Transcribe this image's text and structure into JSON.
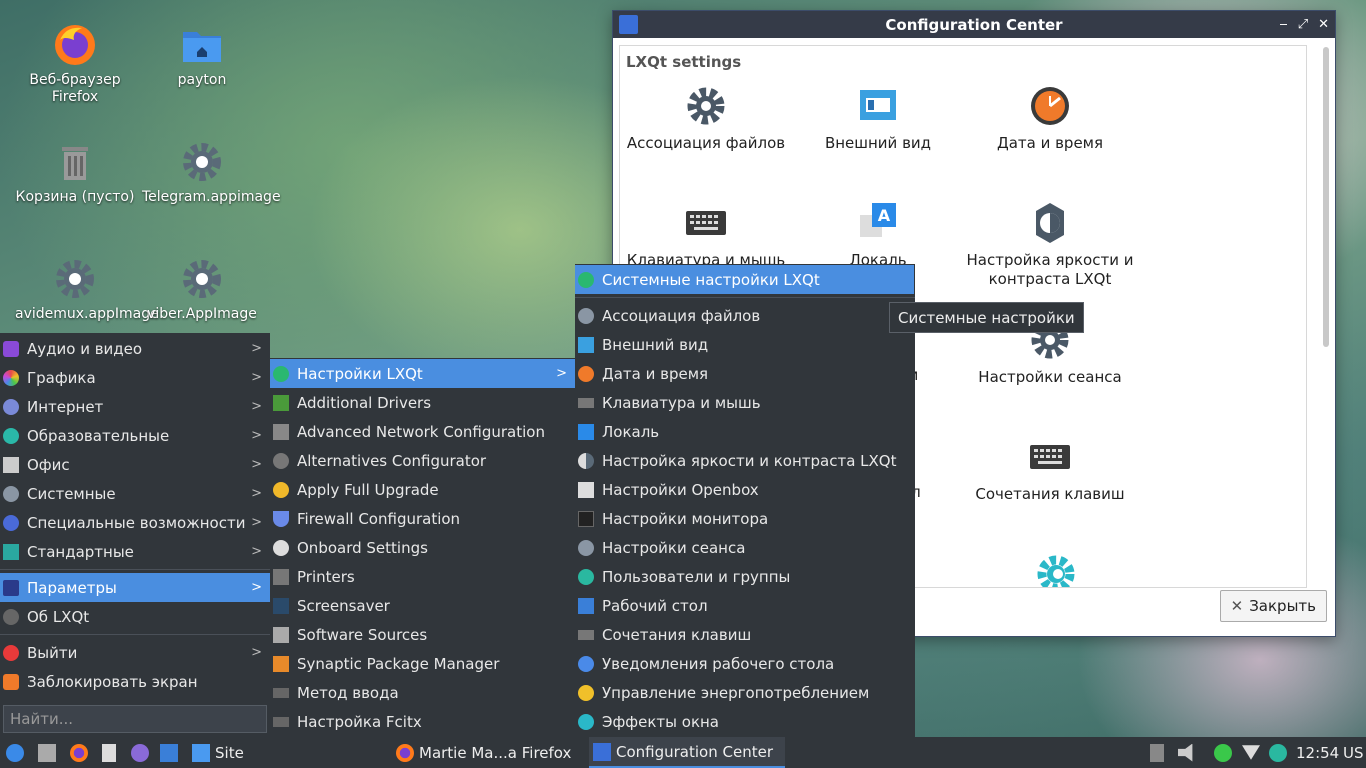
{
  "desktop": {
    "icons": [
      {
        "label": "Веб-браузер Firefox",
        "icon": "firefox-icon"
      },
      {
        "label": "payton",
        "icon": "folder-icon"
      },
      {
        "label": "Корзина (пусто)",
        "icon": "trash-icon"
      },
      {
        "label": "Telegram.appimage",
        "icon": "gear-icon"
      },
      {
        "label": "avidemux.appImage",
        "icon": "gear-icon"
      },
      {
        "label": "viber.AppImage",
        "icon": "gear-icon"
      }
    ]
  },
  "window": {
    "title": "Configuration Center",
    "section": "LXQt settings",
    "items": [
      {
        "label": "Ассоциация файлов"
      },
      {
        "label": "Внешний вид"
      },
      {
        "label": "Дата и время"
      },
      {
        "label": "Клавиатура и мышь"
      },
      {
        "label": "Локаль"
      },
      {
        "label": "Настройка яркости и контраста LXQt"
      },
      {
        "label": "Настройки сеанса"
      },
      {
        "label": "Сочетания клавиш"
      }
    ],
    "partial_labels": [
      "м",
      "ол"
    ],
    "close_label": "Закрыть",
    "controls": [
      "‒",
      "⤢",
      "✕"
    ]
  },
  "main_menu": {
    "items": [
      {
        "label": "Аудио и видео",
        "has_sub": true
      },
      {
        "label": "Графика",
        "has_sub": true
      },
      {
        "label": "Интернет",
        "has_sub": true
      },
      {
        "label": "Образовательные",
        "has_sub": true
      },
      {
        "label": "Офис",
        "has_sub": true
      },
      {
        "label": "Системные",
        "has_sub": true
      },
      {
        "label": "Специальные возможности",
        "has_sub": true
      },
      {
        "label": "Стандартные",
        "has_sub": true
      },
      {
        "label": "Параметры",
        "has_sub": true,
        "active": true
      },
      {
        "label": "Об LXQt",
        "has_sub": false
      },
      {
        "label": "Выйти",
        "has_sub": true
      },
      {
        "label": "Заблокировать экран",
        "has_sub": false
      }
    ],
    "search_placeholder": "Найти..."
  },
  "params_menu": {
    "items": [
      {
        "label": "Настройки LXQt",
        "active": true
      },
      {
        "label": "Additional Drivers"
      },
      {
        "label": "Advanced Network Configuration"
      },
      {
        "label": "Alternatives Configurator"
      },
      {
        "label": "Apply Full Upgrade"
      },
      {
        "label": "Firewall Configuration"
      },
      {
        "label": "Onboard Settings"
      },
      {
        "label": "Printers"
      },
      {
        "label": "Screensaver"
      },
      {
        "label": "Software Sources"
      },
      {
        "label": "Synaptic Package Manager"
      },
      {
        "label": "Метод ввода"
      },
      {
        "label": "Настройка Fcitx"
      }
    ]
  },
  "lxqt_menu": {
    "header": "Системные настройки LXQt",
    "items": [
      {
        "label": "Ассоциация файлов"
      },
      {
        "label": "Внешний вид"
      },
      {
        "label": "Дата и время"
      },
      {
        "label": "Клавиатура и мышь"
      },
      {
        "label": "Локаль"
      },
      {
        "label": "Настройка яркости и контраста LXQt"
      },
      {
        "label": "Настройки Openbox"
      },
      {
        "label": "Настройки монитора"
      },
      {
        "label": "Настройки сеанса"
      },
      {
        "label": "Пользователи и группы"
      },
      {
        "label": "Рабочий стол"
      },
      {
        "label": "Сочетания клавиш"
      },
      {
        "label": "Уведомления рабочего стола"
      },
      {
        "label": "Управление энергопотреблением"
      },
      {
        "label": "Эффекты окна"
      }
    ]
  },
  "tooltip": "Системные настройки",
  "taskbar": {
    "quicklaunch_label": "Site",
    "tasks": [
      {
        "label": "Martie Ma...a Firefox"
      },
      {
        "label": "Configuration Center",
        "active": true
      }
    ],
    "clock": "12:54",
    "layout": "US"
  },
  "colors": {
    "accent": "#4a8ee0",
    "menu_bg": "#31363b",
    "titlebar": "#353b48"
  }
}
